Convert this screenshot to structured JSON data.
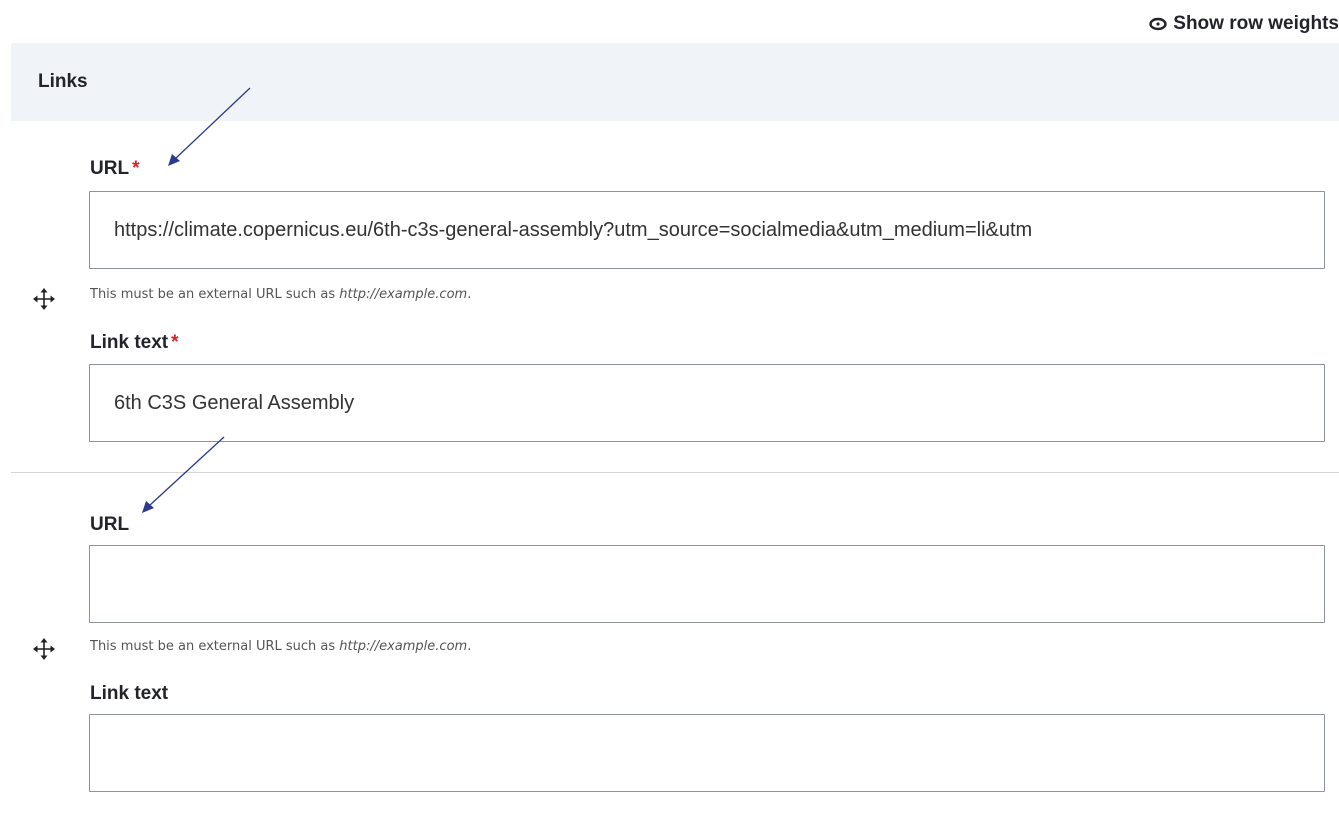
{
  "toolbar": {
    "row_weights_label": "Show row weights",
    "row_weights_icon": "eye-icon"
  },
  "table": {
    "header_label": "Links",
    "rows": [
      {
        "url_label": "URL",
        "url_required_mark": "*",
        "url_value": "https://climate.copernicus.eu/6th-c3s-general-assembly?utm_source=socialmedia&utm_medium=li&utm",
        "url_description_prefix": "This must be an external URL such as ",
        "url_description_example": "http://example.com",
        "url_description_suffix": ".",
        "link_text_label": "Link text",
        "link_text_required_mark": "*",
        "link_text_value": "6th C3S General Assembly",
        "drag_icon": "move-arrows-icon"
      },
      {
        "url_label": "URL",
        "url_value": "",
        "url_description_prefix": "This must be an external URL such as ",
        "url_description_example": "http://example.com",
        "url_description_suffix": ".",
        "link_text_label": "Link text",
        "link_text_value": "",
        "drag_icon": "move-arrows-icon"
      }
    ]
  },
  "colors": {
    "header_bg": "#f0f3f8",
    "required": "#d72222",
    "input_border": "#8e929c",
    "annotation_arrow": "#2b3a8f"
  }
}
